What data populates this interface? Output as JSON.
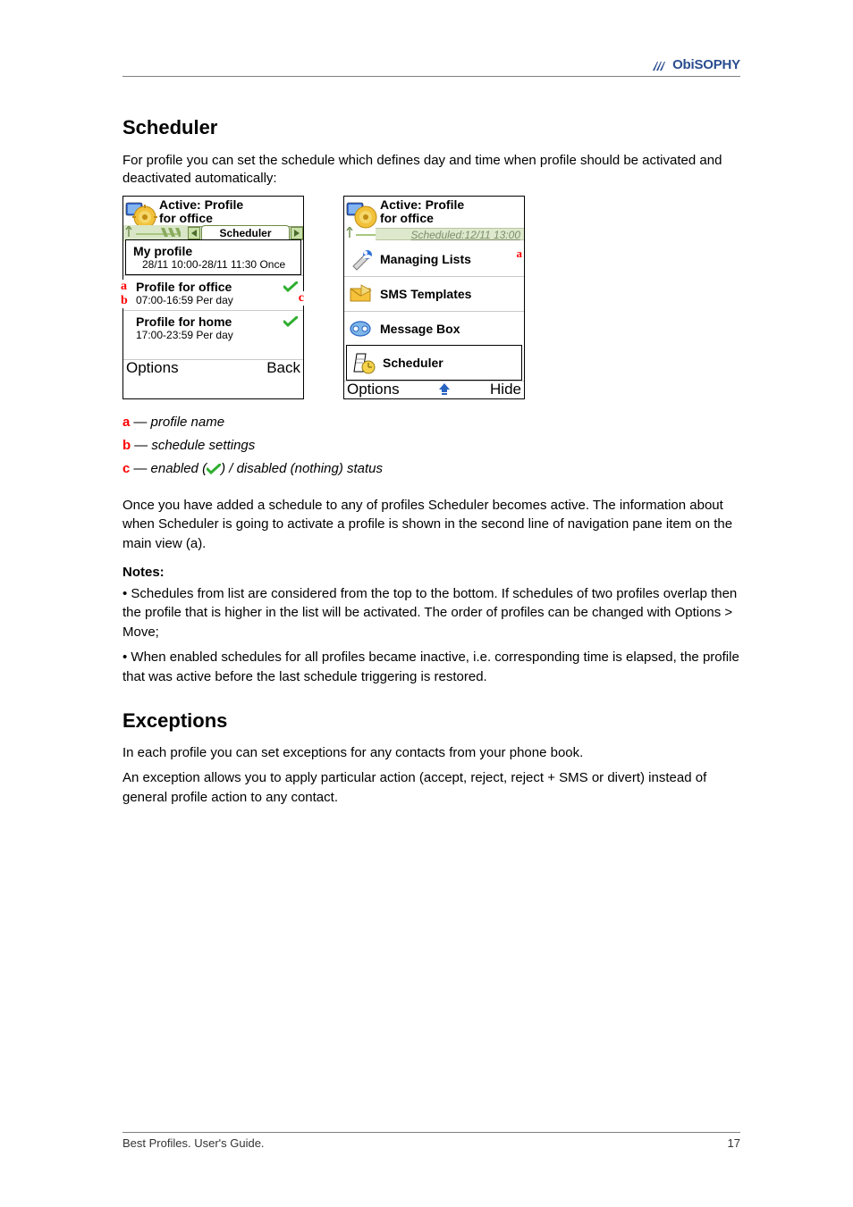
{
  "brand": {
    "name": "ObiSOPHY"
  },
  "heading": "Scheduler",
  "intro": "For profile you can set the schedule which defines day and time when profile should be activated and deactivated automatically:",
  "screenshots": {
    "left": {
      "active_line1": "Active: Profile",
      "active_line2": "for office",
      "tab": "Scheduler",
      "items": [
        {
          "name": "My profile",
          "time": "28/11 10:00-28/11 11:30 Once",
          "check": false,
          "selected": true,
          "marker": ""
        },
        {
          "name": "Profile for office",
          "time": "07:00-16:59 Per day",
          "check": true,
          "selected": false,
          "marker": "a",
          "marker2": "b",
          "marker3": "c"
        },
        {
          "name": "Profile for home",
          "time": "17:00-23:59 Per day",
          "check": true,
          "selected": false
        }
      ],
      "softleft": "Options",
      "softright": "Back"
    },
    "right": {
      "active_line1": "Active: Profile",
      "active_line2": "for office",
      "scheduled_line": "Scheduled:12/11 13:00",
      "callout": "a",
      "menu": [
        {
          "label": "Managing Lists"
        },
        {
          "label": "SMS Templates"
        },
        {
          "label": "Message Box"
        },
        {
          "label": "Scheduler",
          "selected": true
        }
      ],
      "softleft": "Options",
      "softright": "Hide"
    }
  },
  "legend": {
    "a": "profile name",
    "b": "schedule settings",
    "c": "enabled ( ) / disabled (nothing) status"
  },
  "explain_p1": "Once you have added a schedule to any of profiles Scheduler becomes active. The information about when Scheduler is going to activate a profile is shown in the second line of navigation pane item on the main view (a).",
  "notes_title": "Notes:",
  "notes": [
    "Schedules from list are considered from the top to the bottom. If schedules of two profiles overlap then the profile that is higher in the list will be activated. The order of profiles can be changed with Options > Move;",
    "When enabled schedules for all profiles became inactive, i.e. corresponding time is elapsed, the profile that was active before the last schedule triggering is restored."
  ],
  "next_heading": "Exceptions",
  "next_body": [
    "In each profile you can set exceptions for any contacts from your phone book.",
    "An exception allows you to apply particular action (accept, reject, reject + SMS or divert) instead of general profile action to any contact."
  ],
  "footer": {
    "left": "Best Profiles. User's Guide.",
    "right": "17"
  }
}
